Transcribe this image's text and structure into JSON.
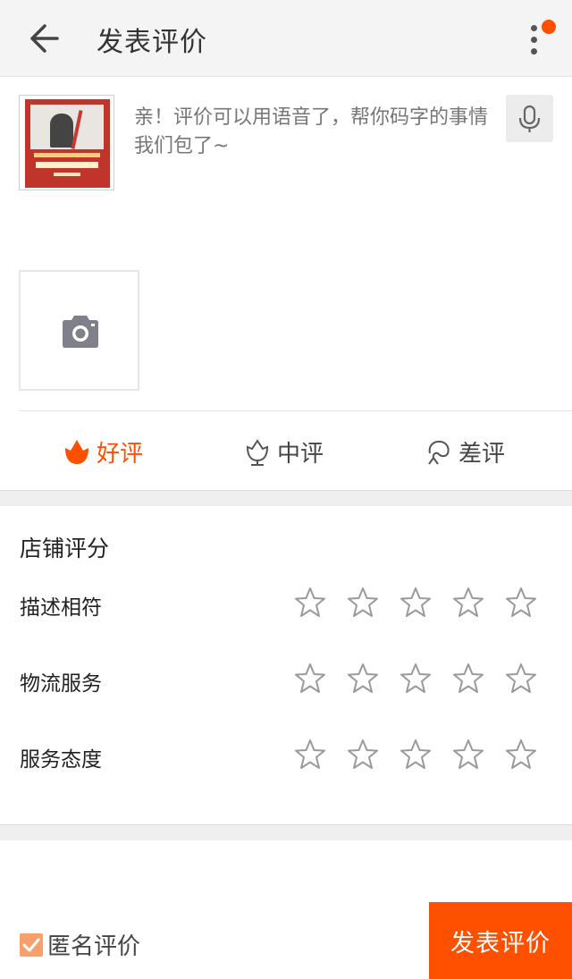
{
  "header": {
    "title": "发表评价"
  },
  "composer": {
    "placeholder": "亲！评价可以用语音了，帮你码字的事情我们包了~"
  },
  "ratings": {
    "good": "好评",
    "mid": "中评",
    "bad": "差评"
  },
  "shop": {
    "title": "店铺评分",
    "rows": [
      {
        "label": "描述相符",
        "stars": 0
      },
      {
        "label": "物流服务",
        "stars": 0
      },
      {
        "label": "服务态度",
        "stars": 0
      }
    ]
  },
  "footer": {
    "anonymous_label": "匿名评价",
    "anonymous_checked": true,
    "submit_label": "发表评价"
  },
  "colors": {
    "accent": "#ff5000",
    "checkbox": "#f7a06b"
  }
}
